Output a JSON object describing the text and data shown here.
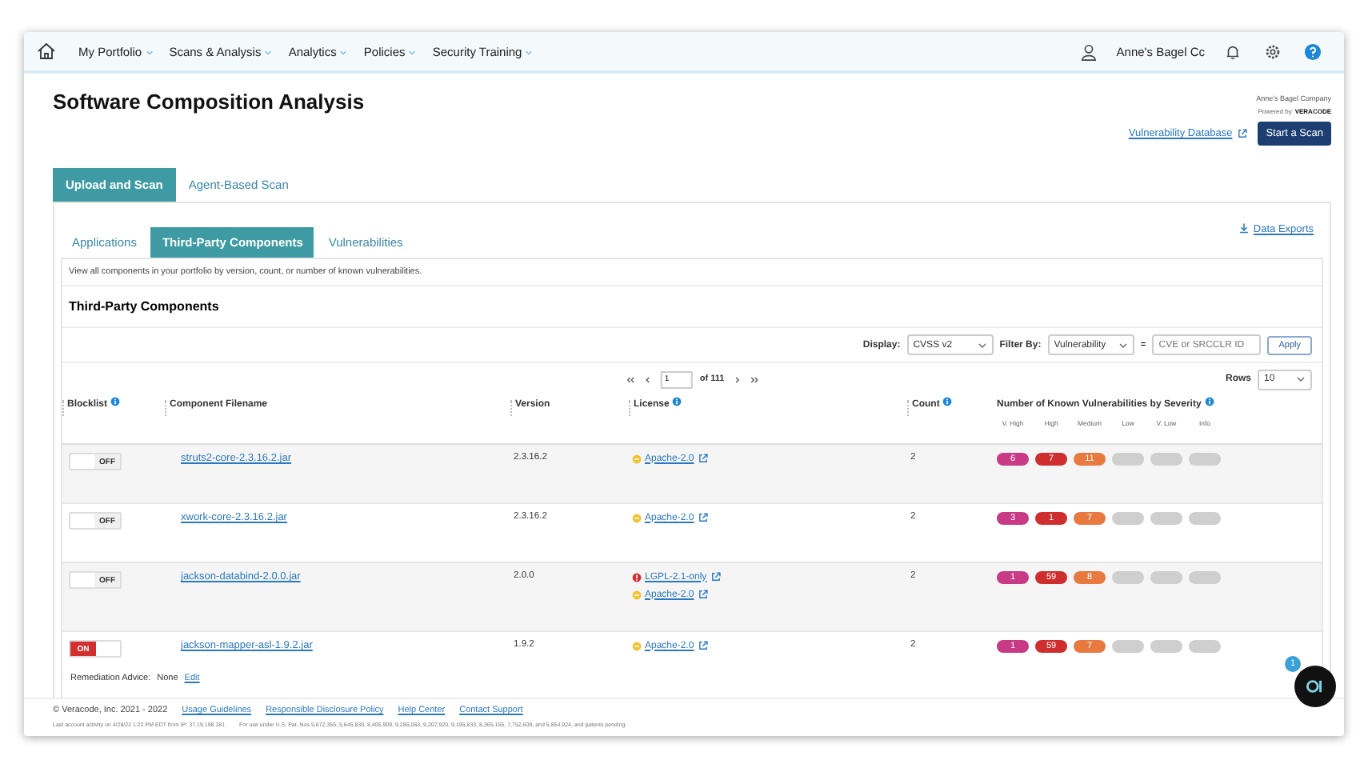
{
  "nav": {
    "items": [
      {
        "label": "My Portfolio"
      },
      {
        "label": "Scans & Analysis"
      },
      {
        "label": "Analytics"
      },
      {
        "label": "Policies"
      },
      {
        "label": "Security Training"
      }
    ],
    "account": "Anne's Bagel Cc"
  },
  "page_title": "Software Composition Analysis",
  "brand": {
    "company": "Anne's Bagel Company",
    "powered_by": "Powered by",
    "vendor": "VERACODE"
  },
  "vuln_db_link": "Vulnerability Database",
  "start_scan": "Start a Scan",
  "tabs": [
    {
      "label": "Upload and Scan",
      "selected": true
    },
    {
      "label": "Agent-Based Scan",
      "selected": false
    }
  ],
  "subtabs": [
    {
      "label": "Applications",
      "selected": false
    },
    {
      "label": "Third-Party Components",
      "selected": true
    },
    {
      "label": "Vulnerabilities",
      "selected": false
    }
  ],
  "data_exports": "Data Exports",
  "description": "View all components in your portfolio by version, count, or number of known vulnerabilities.",
  "section_title": "Third-Party Components",
  "filters": {
    "display_label": "Display:",
    "display_value": "CVSS v2",
    "filter_label": "Filter By:",
    "filter_value": "Vulnerability",
    "equals": "=",
    "search_placeholder": "CVE or SRCCLR ID",
    "apply": "Apply"
  },
  "pager": {
    "page": "1",
    "of": "of 111",
    "rows_label": "Rows",
    "rows_value": "10"
  },
  "table": {
    "columns": [
      "Blocklist",
      "Component Filename",
      "Version",
      "License",
      "Count",
      "Number of Known Vulnerabilities by Severity"
    ],
    "severity_levels": [
      "V. High",
      "High",
      "Medium",
      "Low",
      "V. Low",
      "Info"
    ],
    "rows": [
      {
        "blocklist": {
          "on": false,
          "label": "OFF"
        },
        "file": "struts2-core-2.3.16.2.jar",
        "version": "2.3.16.2",
        "licenses": [
          {
            "name": "Apache-2.0",
            "kind": "medium"
          }
        ],
        "count": "2",
        "severity": [
          "6",
          "7",
          "11"
        ]
      },
      {
        "blocklist": {
          "on": false,
          "label": "OFF"
        },
        "file": "xwork-core-2.3.16.2.jar",
        "version": "2.3.16.2",
        "licenses": [
          {
            "name": "Apache-2.0",
            "kind": "medium"
          }
        ],
        "count": "2",
        "severity": [
          "3",
          "1",
          "7"
        ]
      },
      {
        "blocklist": {
          "on": false,
          "label": "OFF"
        },
        "file": "jackson-databind-2.0.0.jar",
        "version": "2.0.0",
        "licenses": [
          {
            "name": "LGPL-2.1-only",
            "kind": "high"
          },
          {
            "name": "Apache-2.0",
            "kind": "medium"
          }
        ],
        "count": "2",
        "severity": [
          "1",
          "59",
          "8"
        ]
      },
      {
        "blocklist": {
          "on": true,
          "label": "ON"
        },
        "file": "jackson-mapper-asl-1.9.2.jar",
        "version": "1.9.2",
        "licenses": [
          {
            "name": "Apache-2.0",
            "kind": "medium"
          }
        ],
        "count": "2",
        "severity": [
          "1",
          "59",
          "7"
        ]
      }
    ]
  },
  "remediation": {
    "label": "Remediation Advice:",
    "value": "None",
    "edit": "Edit"
  },
  "chat_badge": "1",
  "footer": {
    "copyright": "© Veracode, Inc. 2021 - 2022",
    "links": [
      "Usage Guidelines",
      "Responsible Disclosure Policy",
      "Help Center",
      "Contact Support"
    ],
    "last_activity": "Last account activity on 4/28/22 1:22 PM EDT from IP: 37.19.198.181",
    "patents": "For use under U.S. Pat. Nos 5,672,355, 5,645,830, 8,405,909, 9,286,063, 9,207,920, 9,195,833, 8,365,155, 7,752,609, and 5,854,924, and patents pending."
  }
}
